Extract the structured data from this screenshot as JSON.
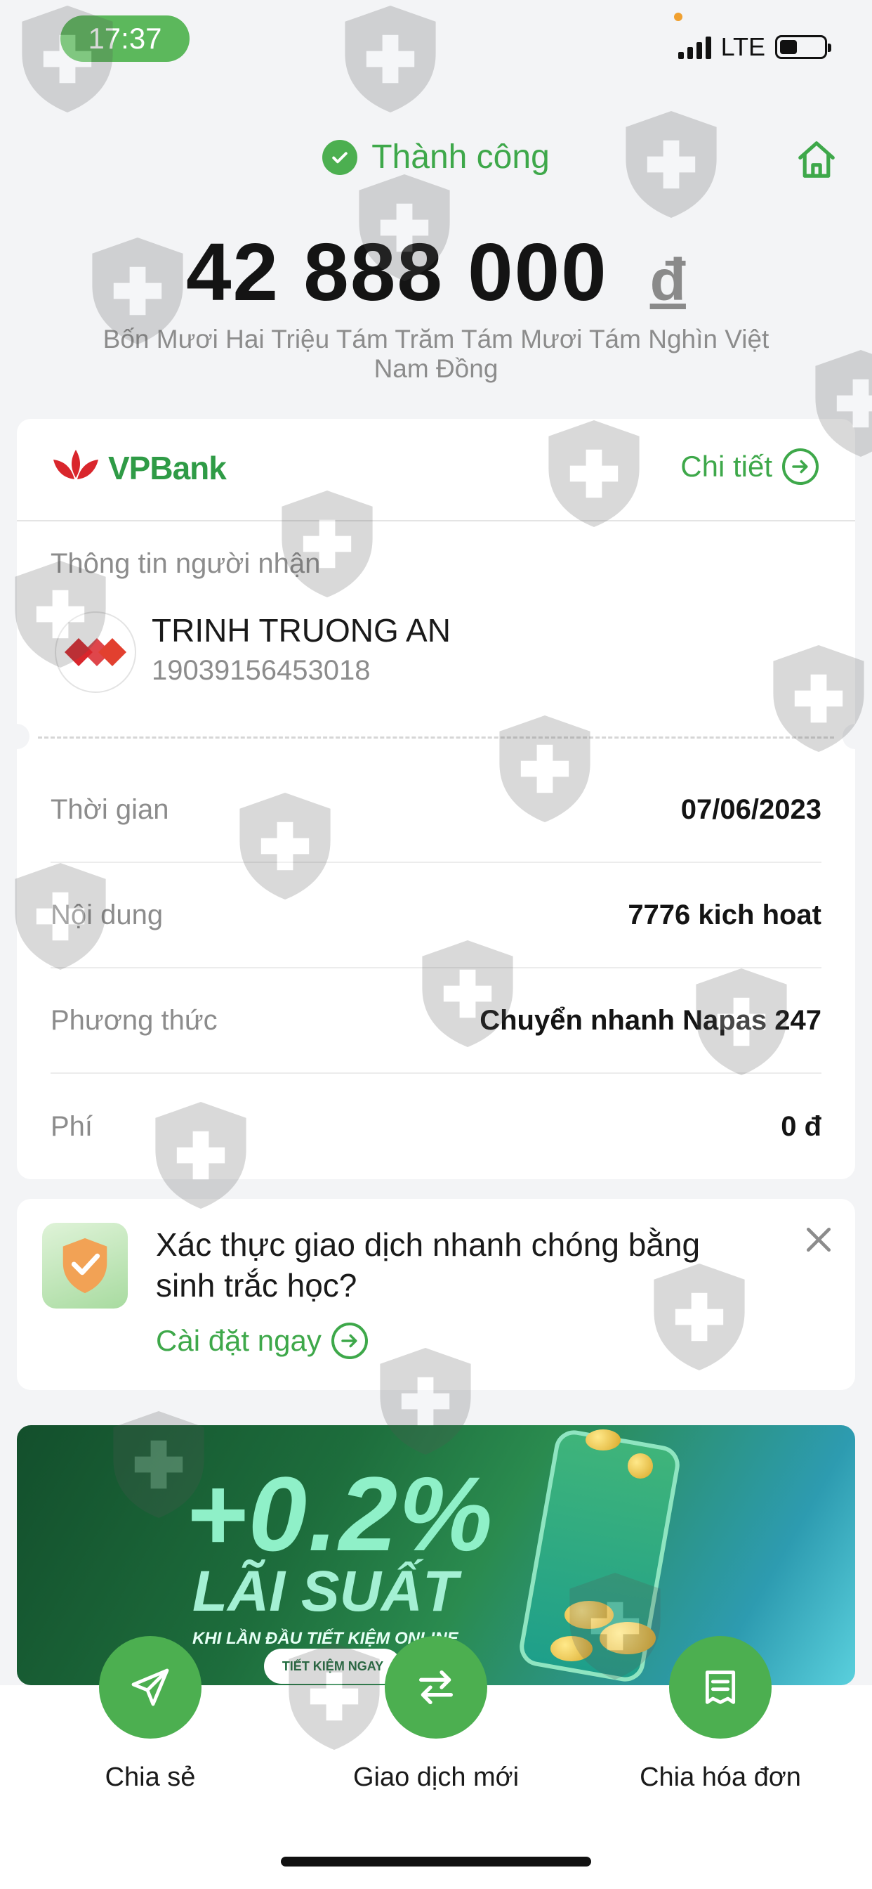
{
  "status_bar": {
    "time": "17:37",
    "network": "LTE"
  },
  "header": {
    "status": "Thành công",
    "amount": "42 888 000",
    "currency_symbol": "đ",
    "amount_in_words": "Bốn Mươi Hai Triệu Tám Trăm Tám Mươi Tám Nghìn Việt Nam Đồng"
  },
  "card": {
    "bank_name": "VPBank",
    "detail_link": "Chi tiết",
    "recipient_title": "Thông tin người nhận",
    "recipient_name": "TRINH TRUONG AN",
    "recipient_account": "19039156453018",
    "rows": [
      {
        "label": "Thời gian",
        "value": "07/06/2023"
      },
      {
        "label": "Nội dung",
        "value": "7776 kich hoat"
      },
      {
        "label": "Phương thức",
        "value": "Chuyển nhanh Napas 247"
      },
      {
        "label": "Phí",
        "value": "0 đ"
      }
    ]
  },
  "biometric": {
    "title": "Xác thực giao dịch nhanh chóng bằng sinh trắc học?",
    "link": "Cài đặt ngay"
  },
  "banner": {
    "rate": "+0.2%",
    "title": "LÃI SUẤT",
    "subtitle": "KHI LẦN ĐẦU TIẾT KIỆM ONLINE",
    "button": "TIẾT KIỆM NGAY"
  },
  "actions": [
    {
      "label": "Chia sẻ",
      "icon": "send-icon"
    },
    {
      "label": "Giao dịch mới",
      "icon": "swap-icon"
    },
    {
      "label": "Chia hóa đơn",
      "icon": "bill-icon"
    }
  ],
  "colors": {
    "accent": "#4caf50",
    "accent_text": "#3ea84a",
    "brand_red": "#d9262c"
  }
}
